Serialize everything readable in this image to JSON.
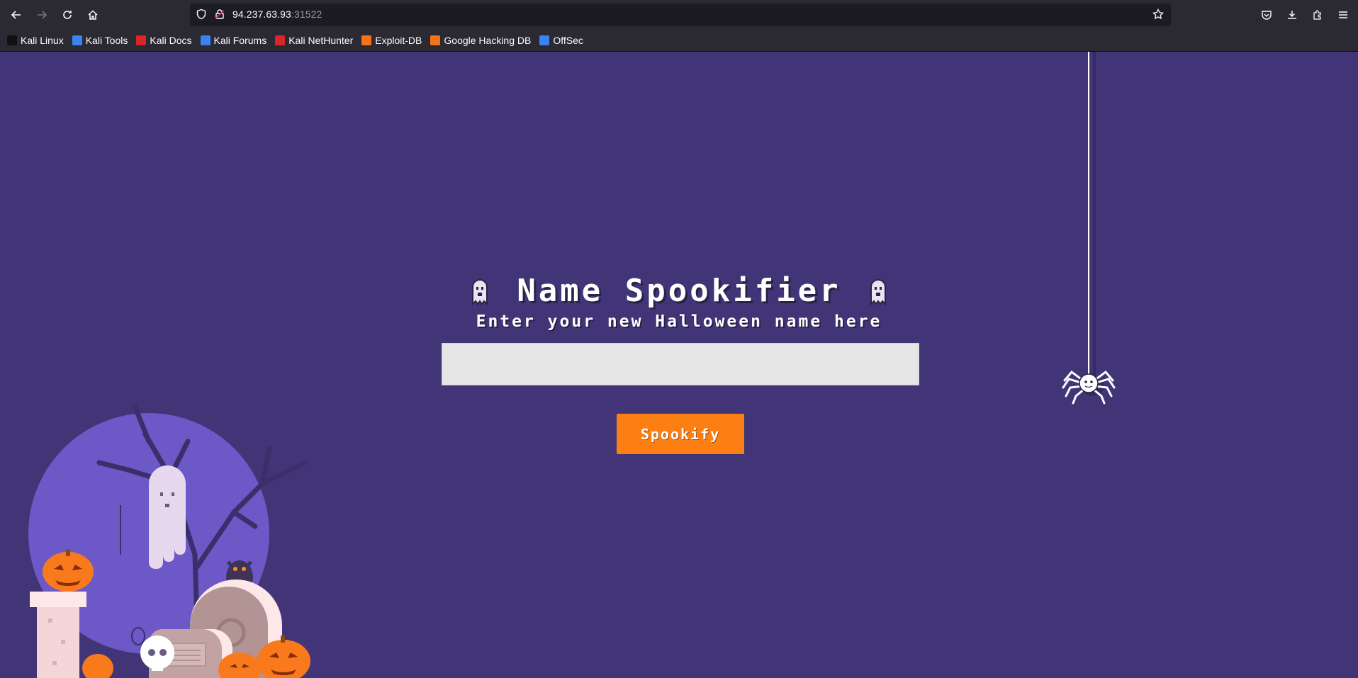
{
  "browser": {
    "url_host": "94.237.63.93",
    "url_port": ":31522",
    "bookmarks": [
      {
        "label": "Kali Linux",
        "icon": "kali-dragon-icon",
        "color": "#111111"
      },
      {
        "label": "Kali Tools",
        "icon": "kali-tools-icon",
        "color": "#3b82f6"
      },
      {
        "label": "Kali Docs",
        "icon": "kali-docs-icon",
        "color": "#dc2626"
      },
      {
        "label": "Kali Forums",
        "icon": "kali-forums-icon",
        "color": "#3b82f6"
      },
      {
        "label": "Kali NetHunter",
        "icon": "nethunter-icon",
        "color": "#dc2626"
      },
      {
        "label": "Exploit-DB",
        "icon": "exploit-db-icon",
        "color": "#f97316"
      },
      {
        "label": "Google Hacking DB",
        "icon": "ghdb-icon",
        "color": "#f97316"
      },
      {
        "label": "OffSec",
        "icon": "offsec-icon",
        "color": "#3b82f6"
      }
    ]
  },
  "page": {
    "title": "Name Spookifier",
    "subtitle": "Enter your new Halloween name here",
    "name_input": {
      "value": "",
      "placeholder": ""
    },
    "submit_label": "Spookify"
  },
  "colors": {
    "background": "#423577",
    "button": "#fc7f14",
    "input": "#e6e6e6"
  }
}
